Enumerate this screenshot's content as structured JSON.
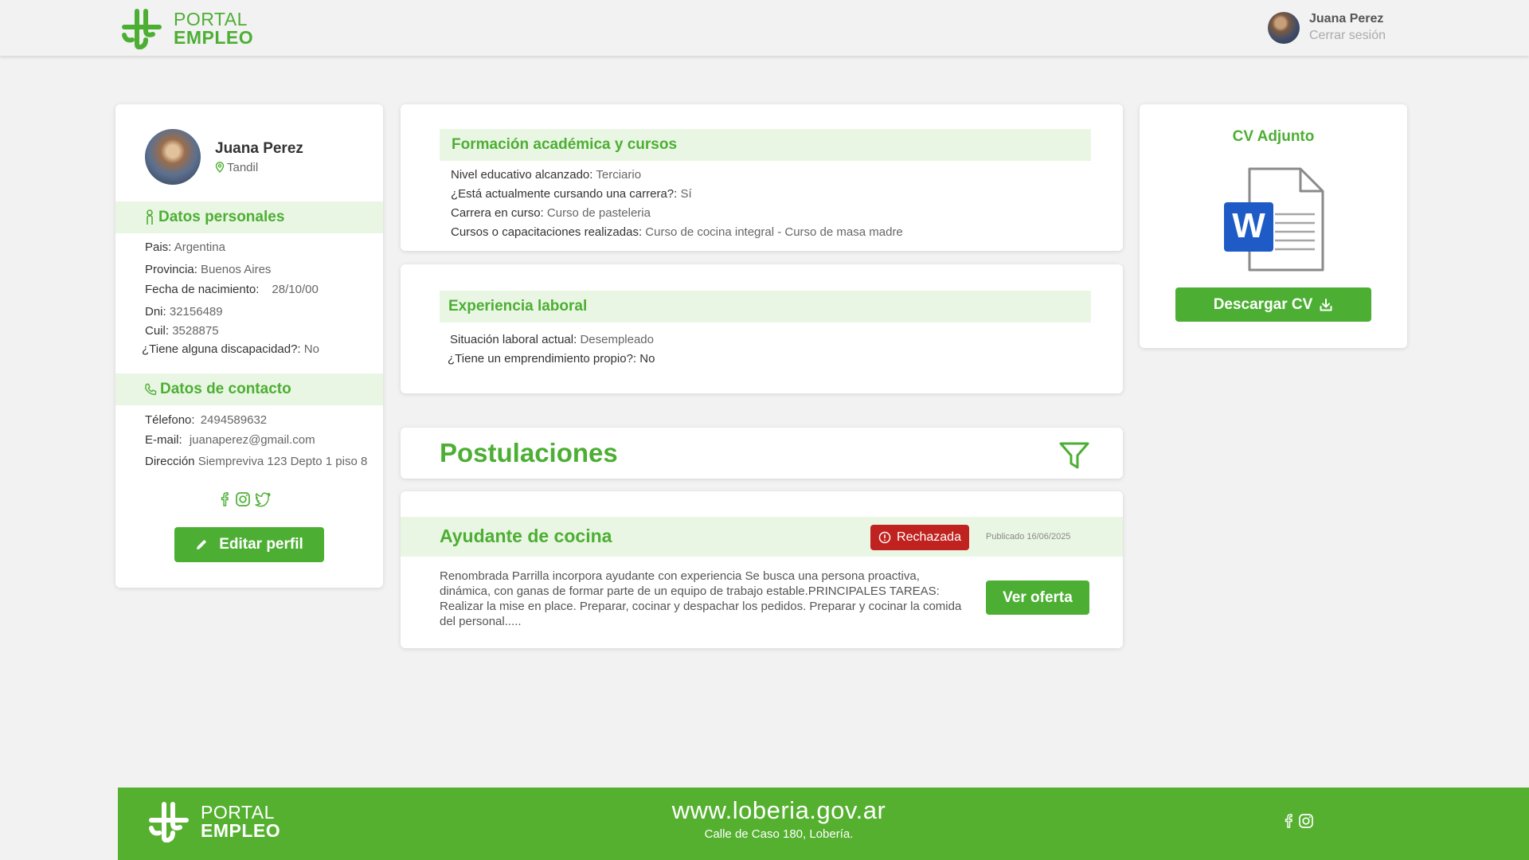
{
  "header": {
    "logo_line1": "PORTAL",
    "logo_line2": "EMPLEO",
    "user_name": "Juana Perez",
    "logout_label": "Cerrar sesión"
  },
  "profile": {
    "name": "Juana Perez",
    "location": "Tandil",
    "personal_title": "Datos personales",
    "personal": [
      {
        "label": "Pais:",
        "value": "Argentina"
      },
      {
        "label": "Provincia:",
        "value": "Buenos Aires"
      },
      {
        "label": "Fecha de nacimiento:",
        "value": "28/10/00"
      },
      {
        "label": "Dni:",
        "value": "32156489"
      },
      {
        "label": "Cuil:",
        "value": "3528875"
      },
      {
        "label": "¿Tiene alguna discapacidad?:",
        "value": "No"
      }
    ],
    "contact_title": "Datos de contacto",
    "contact": [
      {
        "label": "Télefono:",
        "value": "2494589632"
      },
      {
        "label": "E-mail:",
        "value": "juanaperez@gmail.com"
      },
      {
        "label": "Dirección",
        "value": "Siempreviva 123 Depto 1 piso 8"
      }
    ],
    "edit_label": "Editar perfil"
  },
  "formacion": {
    "title": "Formación académica y cursos",
    "lines": [
      {
        "label": "Nivel educativo alcanzado:",
        "value": "Terciario"
      },
      {
        "label": "¿Está actualmente cursando una carrera?:",
        "value": "Sí"
      },
      {
        "label": "Carrera en curso:",
        "value": "Curso de pasteleria"
      },
      {
        "label": "Cursos o capacitaciones realizadas:",
        "value": "Curso de cocina integral - Curso de masa madre"
      }
    ]
  },
  "experiencia": {
    "title": "Experiencia laboral",
    "lines": [
      {
        "label": "Situación laboral actual:",
        "value": "Desempleado"
      },
      {
        "label": "¿Tiene un emprendimiento propio?:",
        "value": "No"
      }
    ]
  },
  "postulaciones": {
    "title": "Postulaciones",
    "jobs": [
      {
        "title": "Ayudante de cocina",
        "status": "Rechazada",
        "published": "Publicado 16/06/2025",
        "description": "Renombrada Parrilla incorpora ayudante con experiencia Se busca una persona proactiva, dinámica, con ganas de formar parte de un equipo de trabajo estable.PRINCIPALES TAREAS: Realizar la mise en place. Preparar, cocinar y despachar los pedidos. Preparar y cocinar la comida del personal.....",
        "button": "Ver oferta"
      }
    ]
  },
  "cv": {
    "title": "CV Adjunto",
    "file_letter": "W",
    "download_label": "Descargar CV"
  },
  "footer": {
    "logo_line1": "PORTAL",
    "logo_line2": "EMPLEO",
    "url": "www.loberia.gov.ar",
    "address": "Calle de Caso 180, Lobería."
  },
  "colors": {
    "brand_green": "#4caf33",
    "light_green": "#eaf6e4",
    "badge_red": "#c0221f",
    "word_blue": "#1f5bc6"
  }
}
